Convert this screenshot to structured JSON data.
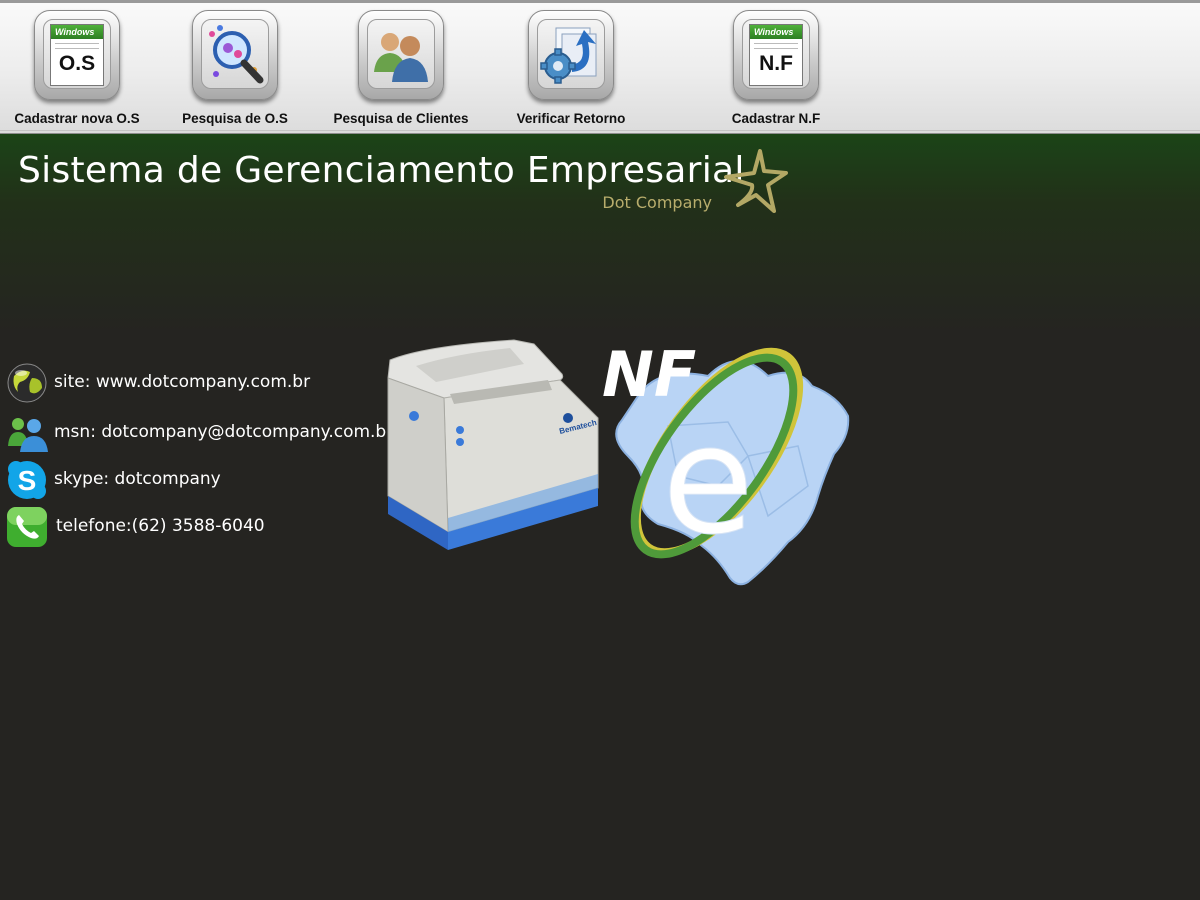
{
  "toolbar": {
    "items": [
      {
        "label": "Cadastrar nova O.S",
        "icon": "os-document-icon",
        "doc_text": "O.S"
      },
      {
        "label": "Pesquisa de O.S",
        "icon": "magnifier-search-icon"
      },
      {
        "label": "Pesquisa de Clientes",
        "icon": "clients-people-icon"
      },
      {
        "label": "Verificar Retorno",
        "icon": "gear-refresh-icon"
      },
      {
        "label": "Cadastrar N.F",
        "icon": "nf-document-icon",
        "doc_text": "N.F"
      }
    ],
    "doc_brand": "Windows"
  },
  "header": {
    "title": "Sistema de Gerenciamento Empresarial",
    "subtitle": "Dot Company",
    "logo_icon": "star-logo-icon"
  },
  "contacts": [
    {
      "text": "site: www.dotcompany.com.br",
      "icon": "globe-icon"
    },
    {
      "text": "msn: dotcompany@dotcompany.com.br",
      "icon": "msn-icon"
    },
    {
      "text": "skype: dotcompany",
      "icon": "skype-icon"
    },
    {
      "text": "telefone:(62) 3588-6040",
      "icon": "phone-icon"
    }
  ],
  "printer": {
    "brand": "Bematech",
    "icon": "printer-icon"
  },
  "nfe": {
    "text_nf": "NF",
    "text_e": "e",
    "icon": "nfe-logo-icon"
  },
  "colors": {
    "background": "#252421",
    "header_green": "#1b4417",
    "subtitle_gold": "#b8ad6c",
    "toolbar": "#ececec"
  }
}
